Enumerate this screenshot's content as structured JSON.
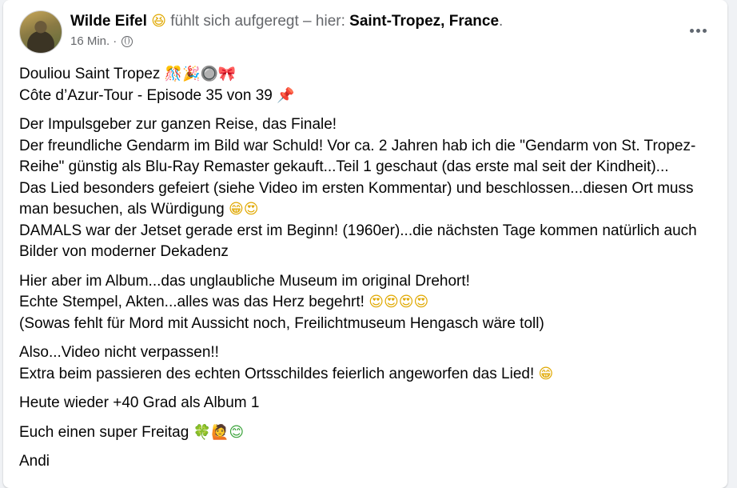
{
  "post": {
    "author": "Wilde Eifel",
    "feeling_emoji": "😆",
    "feeling_text": " fühlt sich aufgeregt – hier: ",
    "location": "Saint-Tropez, France",
    "location_suffix": ".",
    "time": "16 Min.",
    "separator": " · ",
    "more_icon": "more-horizontal-icon",
    "privacy_icon": "globe-icon"
  },
  "content": {
    "p1": {
      "line1": "Douliou Saint Tropez ",
      "line1_emojis": "🎊🎉🔘🎀",
      "line2": "Côte d’Azur-Tour - Episode 35 von 39 ",
      "line2_emoji": "📌"
    },
    "p2": {
      "line1": "Der Impulsgeber zur ganzen Reise, das Finale!",
      "line2": "Der freundliche Gendarm im Bild war Schuld! Vor ca. 2 Jahren hab ich die \"Gendarm von St. Tropez-",
      "line3": "Reihe\" günstig als Blu-Ray Remaster gekauft...Teil 1 geschaut (das erste mal seit der Kindheit)...",
      "line4": "Das Lied besonders gefeiert (siehe Video im ersten Kommentar) und beschlossen...diesen Ort muss",
      "line5": "man besuchen, als Würdigung ",
      "line5_emojis": "😁😍",
      "line6": "DAMALS war der Jetset gerade erst im Beginn! (1960er)...die nächsten Tage kommen natürlich auch",
      "line7": "Bilder von moderner Dekadenz"
    },
    "p3": {
      "line1": "Hier aber im Album...das unglaubliche Museum im original Drehort!",
      "line2": "Echte Stempel, Akten...alles was das Herz begehrt! ",
      "line2_emojis": "😍😍😍😍",
      "line3": "(Sowas fehlt für Mord mit Aussicht noch, Freilichtmuseum Hengasch wäre toll)"
    },
    "p4": {
      "line1": "Also...Video nicht verpassen!!",
      "line2": "Extra beim passieren des echten Ortsschildes feierlich angeworfen das Lied! ",
      "line2_emoji": "😁"
    },
    "p5": {
      "line1": "Heute wieder +40 Grad als Album 1"
    },
    "p6": {
      "line1": "Euch einen super Freitag ",
      "line1_emojis": "🍀🙋😊"
    },
    "p7": {
      "line1": "Andi"
    }
  },
  "colors": {
    "background": "#f0f2f5",
    "card": "#ffffff",
    "text": "#050505",
    "secondary": "#65676b"
  }
}
